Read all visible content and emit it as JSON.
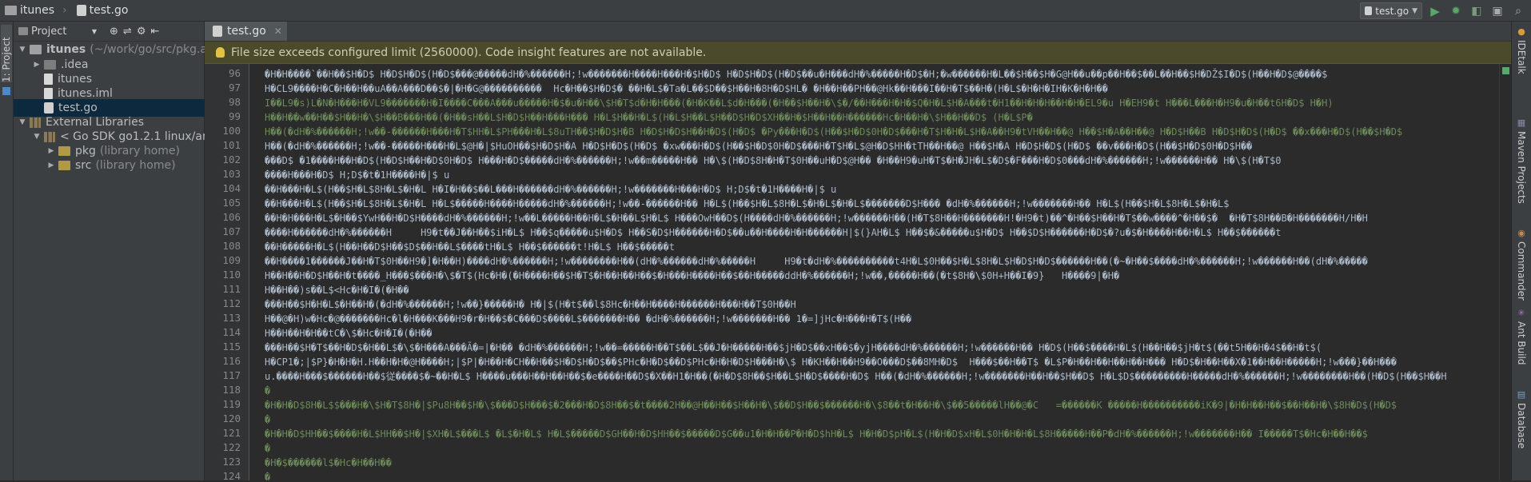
{
  "navbar": {
    "project_crumb": "itunes",
    "file_crumb": "test.go",
    "run_config": "test.go"
  },
  "left_stripe": {
    "project_tab": "1: Project"
  },
  "right_stripe": {
    "tabs": [
      "IDEtalk",
      "Maven Projects",
      "Commander",
      "Ant Build",
      "Database"
    ]
  },
  "project_panel": {
    "title": "Project",
    "tree": [
      {
        "label": "itunes",
        "suffix": "(~/work/go/src/pkg.a",
        "type": "module",
        "expanded": true
      },
      {
        "label": ".idea",
        "suffix": "",
        "type": "folder",
        "expanded": false
      },
      {
        "label": "itunes",
        "suffix": "",
        "type": "file",
        "expanded": null
      },
      {
        "label": "itunes.iml",
        "suffix": "",
        "type": "file",
        "expanded": null
      },
      {
        "label": "test.go",
        "suffix": "",
        "type": "gofile",
        "selected": true
      },
      {
        "label": "External Libraries",
        "suffix": "",
        "type": "libs",
        "expanded": true
      },
      {
        "label": "< Go SDK go1.2.1 linux/am",
        "suffix": "",
        "type": "sdk",
        "expanded": true
      },
      {
        "label": "pkg",
        "suffix": "(library home)",
        "type": "pkgfolder",
        "expanded": false
      },
      {
        "label": "src",
        "suffix": "(library home)",
        "type": "pkgfolder",
        "expanded": false
      }
    ]
  },
  "editor": {
    "tab_label": "test.go",
    "banner_text": "File size exceeds configured limit (2560000). Code insight features are not available.",
    "lines": [
      {
        "n": "96",
        "text": "�H�H����`��H��$H�D$ H�D$H�D$(H�D$���@�����dH�%������H;!w�������H����H���H�$H�D$ H�D$H�D$(H�D$��u�H���dH�%�����H�D$�H;�w������H�L��$H��$H�G@H��u��p��H��$��L��H��$H�DŽ$I�D$(H��H�D$@����$",
        "green": false
      },
      {
        "n": "97",
        "text": "H�CL9����H�C�H��H��uA��A���D��$�|�H�G@����������  Hc�H��$H�D$� ��H�L$�Ta�L��$D��$H��H�8H�D$HL� �H��H��PH��@Hk��H���I��H�T$��H�(H�L$�H�H�IH�K�H�H��",
        "green": false
      },
      {
        "n": "98",
        "text": "I��L9�s)L�N�H���H�VL9�������H�I����C���A���u�����H�$�u�H��\\$H�T$d�H�H���(�H�K��L$d�H���(�H��$H��H�\\$�/��H���H�H�$Q�H�L$H�A���t�H1��H�H�H��H�H�EL9�u H�EH9�t H���L���H�H9�u�H��t6H�D$ H�H)",
        "green": true
      },
      {
        "n": "99",
        "text": "H��H��w��H��$H��H�\\$H��B���H��(�H��sH��L$H�D$H��H���H��� H�L$H��H�L$(H�L$H��L$H��D$H�D$XH��H�$H��H��H������Hc�H��H�\\$H��H��D$ (H�L$P�",
        "green": true
      },
      {
        "n": "100",
        "text": "H��(�dH�%������H;!w��-������H���H�T$HH�L$PH���H�L$8uTH��$H�D$H�B H�D$H�D$H��H�D$(H�D$ �Py���H�D$(H��$H�D$0H�D$���H�T$H�H�L$H�A��H9�tVH��H��@ H��$H�A��H��@ H�D$H��B H�D$H�D$(H�D$ ��x���H�D$(H��$H�D$",
        "green": true
      },
      {
        "n": "101",
        "text": "H��(�dH�%������H;!w��-�����H���H�L$@H�|$HuOH��$H�D$H�A H�D$H�D$(H�D$ �xw���H�D$(H��$H�D$0H�D$���H�T$H�L$@H�D$HH�tTH��H��@ H��$H�A H�D$H�D$(H�D$ ��v���H�D$(H��$H�D$0H�D$H��",
        "green": false
      },
      {
        "n": "102",
        "text": "���D$ �1����H��H�D$(H�D$H��H�D$0H�D$ H���H�D$�����dH�%������H;!w��m�����H�� H�\\$(H�D$8H�H�T$0H��uH�D$@H�� �H��H9�uH�T$�H�JH�L$�D$�F���H�D$0���dH�%������H;!w������H�� H�\\$(H�T$0",
        "green": false
      },
      {
        "n": "103",
        "text": "����H���H�D$ H;D$�t�1H����H�|$ u",
        "green": false
      },
      {
        "n": "104",
        "text": "��H���H�L$(H��$H�L$8H�L$�H�L H�I�H��$��L���H������dH�%������H;!w�������H���H�D$ H;D$�t�1H����H�|$ u",
        "green": false
      },
      {
        "n": "105",
        "text": "��H���H�L$(H��$H�L$8H�L$�H�L H�L$�����H����H�����dH�%������H;!w��-������H�� H�L$(H��$H�L$8H�L$�H�L$�H�L$�������D$H��� �dH�%������H;!w�������H�� H�L$(H��$H�L$8H�L$�H�L$",
        "green": false
      },
      {
        "n": "106",
        "text": "��H�H���H�L$�H��$YwH��H�D$H����dH�%������H;!w��L�����H��H�L$�H��L$H�L$ H���OwH��D$(H����dH�%������H;!w������H��(H�T$8H��H�������H!�H9�t)��^�H��$H��H�T$��w����^�H��$�  �H�T$8H��B�H�������H/H�H",
        "green": false
      },
      {
        "n": "107",
        "text": "����H������dH�%������H     H9�t��J��H��$iH�L$ H��$q�����u$H�D$ H��S�D$H������H�D$��u��H����H�H������H|$(}AH�L$ H��$�&�����u$H�D$ H��$D$H������H�D$�?u�$�H����H��H�L$ H��$������t",
        "green": false
      },
      {
        "n": "108",
        "text": "��H�����H�L$(H��H��D$H��$D$��H��L$����tH�L$ H��$������t!H�L$ H��$�����t",
        "green": false
      },
      {
        "n": "109",
        "text": "��H����1������J��H�T$0H��H9�]�H��H)����dH�%������H;!w��������H��(dH�%������dH�%�����H     H9�t�dH�%����������t4H�L$0H��$H�L$8H�L$H�D$H�D$������H��(�~�H��$����dH�%������H;!w������H��(dH�%�����",
        "green": false
      },
      {
        "n": "110",
        "text": "H��H��H�D$H��H�t����_H���$���H�\\$�T$(Hc�H�(�H����H��$H�T$�H��H��H��$�H���H����H��$��H�����ddH�%������H;!w��,�����H��(�t$8H�\\$0H+H��I�9}   H����9|�H�",
        "green": false
      },
      {
        "n": "111",
        "text": "H��H��)s��L$<Hc�H�I�(�H��",
        "green": false
      },
      {
        "n": "112",
        "text": "���H��$H�H�L$�H��H�(�dH�%������H;!w��}�����H� H�|$(H�t$��l$8Hc�H��H����H������H���H��T$0H��H",
        "green": false
      },
      {
        "n": "113",
        "text": "H��@�H)w�Hc�@�������Hc�l�H���K���H9�r�H��$�C���D$����L$�������H�� �dH�%������H;!w�������H�� 1�=]jHc�H���H�T$(H��",
        "green": false
      },
      {
        "n": "114",
        "text": "H��H��H�H��tC�\\$�Hc�H�I�(�H��",
        "green": false
      },
      {
        "n": "115",
        "text": "���H��$H�T$��H�D$�H��L$�\\$�H���A���Ã�=|�H�� �dH�%������H;!w��=�����H��T$��L$��J�H�����H��$jH�D$��xH��$�yjH����dH�%������H;!w������H�� H�D$(H��$����H�L$(H��H��$jH�t$(��t5H��H�4$��H�t$(",
        "green": false
      },
      {
        "n": "116",
        "text": "H�CP1�;|$P}�H�H�H.H��H�H�@H����H;|$P|�H��H�CH��H��$H�D$H�D$��$PHc�H�D$��D$PHc�H�H�D$H���H�\\$ H�KH��H��H9��O���D$��8MH�D$  H���$��H��T$ �L$P�H��H��H��H��H��� H�D$�H��H��X�1��H��H�����H;!w���}��H���",
        "green": false
      },
      {
        "n": "117",
        "text": "u.����H���$������H��$従����$�~��H�L$ H����u���H��H��H��$�e����H��D$�X��H1�H��(�H�D$8H��$H��L$H�D$����H�D$ H��(�dH�%������H;!w�������H��H��$H��D$ H�L$D$���������H�����dH�%������H;!w��������H��(H�D$(H��$H��H",
        "green": false
      },
      {
        "n": "118",
        "text": "�",
        "green": true
      },
      {
        "n": "119",
        "text": "�H�H�D$8H�L$$���H�\\$H�T$8H�|$Pu8H��$H�\\$���D$H���$�2���H�D$8H��$�t����2H��@H��H��$H��H�\\$��D$H��$������H�\\$8��t�H��H�\\$��5�����lH��@�C   =������K �����H����������iK�9|�H�H��H��$��H��H�\\$8H�D$(H�D$",
        "green": true
      },
      {
        "n": "120",
        "text": "�",
        "green": true
      },
      {
        "n": "121",
        "text": "�H�H�D$HH��$����H�L$HH��$H�|$XH�L$���L$ �L$�H�L$ H�L$�����D$GH��H�D$HH��$�����D$G��u1�H�H��P�H�D$hH�L$ H�H�D$pH�L$(H�H�D$xH�L$0H�H�H�L$8H�����H��P�dH�%������H;!w�������H�� I�����T$�Hc�H��H��$",
        "green": true
      },
      {
        "n": "122",
        "text": "�",
        "green": true
      },
      {
        "n": "123",
        "text": "�H�$������l$�Hc�H��H��",
        "green": true
      },
      {
        "n": "124",
        "text": "�",
        "green": true
      }
    ]
  },
  "colors": {
    "background": "#2b2b2b",
    "panel": "#3c3f41",
    "selection": "#0d293e",
    "banner": "#4b4a2b",
    "run_green": "#59a869"
  }
}
